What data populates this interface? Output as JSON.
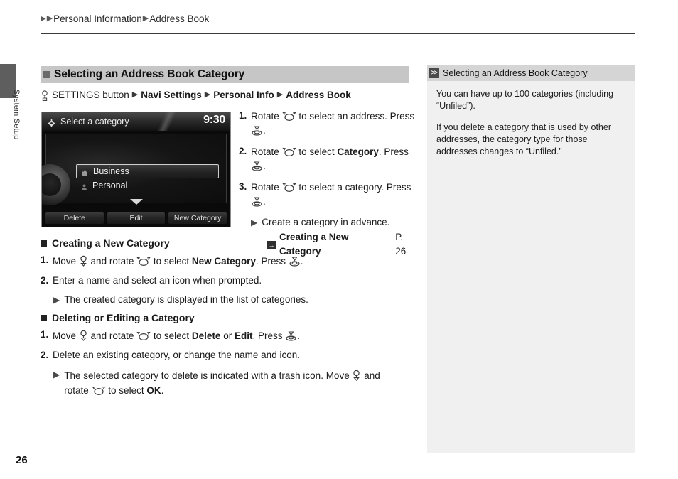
{
  "side_tab": {
    "label": "System Setup"
  },
  "breadcrumb": {
    "item1": "Personal Information",
    "item2": "Address Book"
  },
  "section": {
    "title": "Selecting an Address Book Category",
    "path": {
      "settings_icon": "settings-button-icon",
      "button_text": "SETTINGS button",
      "step1": "Navi Settings",
      "step2": "Personal Info",
      "step3": "Address Book"
    }
  },
  "nav_screen": {
    "gear_icon": "gear-icon",
    "title": "Select a category",
    "clock": "9:30",
    "items": [
      {
        "label": "Business",
        "selected": true
      },
      {
        "label": "Personal",
        "selected": false
      }
    ],
    "buttons": [
      "Delete",
      "Edit",
      "New Category"
    ]
  },
  "steps": [
    {
      "num": "1.",
      "pre": "Rotate",
      "mid": "to select an address.",
      "press": "Press",
      "press_end": "."
    },
    {
      "num": "2.",
      "pre": "Rotate",
      "mid_pre": "to select",
      "bold": "Category",
      "mid_post": ".",
      "press": "Press",
      "press_end": "."
    },
    {
      "num": "3.",
      "pre": "Rotate",
      "mid": "to select a category.",
      "press": "Press",
      "press_end": "."
    }
  ],
  "steps_note": {
    "text": "Create a category in advance.",
    "ref_badge": "→",
    "ref_title": "Creating a New Category",
    "ref_page": "P. 26"
  },
  "creating": {
    "heading": "Creating a New Category",
    "step1": {
      "num": "1.",
      "a": "Move",
      "b": "and rotate",
      "c": "to select",
      "bold": "New Category",
      "d": ". Press",
      "e": "."
    },
    "step2": {
      "num": "2.",
      "text": "Enter a name and select an icon when prompted."
    },
    "note": "The created category is displayed in the list of categories."
  },
  "deleting": {
    "heading": "Deleting or Editing a Category",
    "step1": {
      "num": "1.",
      "a": "Move",
      "b": "and rotate",
      "c": "to select",
      "bold1": "Delete",
      "or": "or",
      "bold2": "Edit",
      "d": ". Press",
      "e": "."
    },
    "step2": {
      "num": "2.",
      "text": "Delete an existing category, or change the name and icon."
    },
    "note_a": "The selected category to delete is indicated with a trash icon. Move",
    "note_b": "and",
    "note_c": "rotate",
    "note_d": "to select",
    "note_bold": "OK",
    "note_e": "."
  },
  "aside": {
    "badge": "≫",
    "title": "Selecting an Address Book Category",
    "paragraphs": [
      "You can have up to 100 categories (including “Unfiled”).",
      "If you delete a category that is used by other addresses, the category type for those addresses changes to “Unfiled.”"
    ]
  },
  "page_number": "26",
  "colors": {
    "band": "#c6c6c6",
    "aside_bg": "#f0f0f0",
    "aside_head": "#d5d5d5",
    "tab": "#5e5e5e"
  }
}
